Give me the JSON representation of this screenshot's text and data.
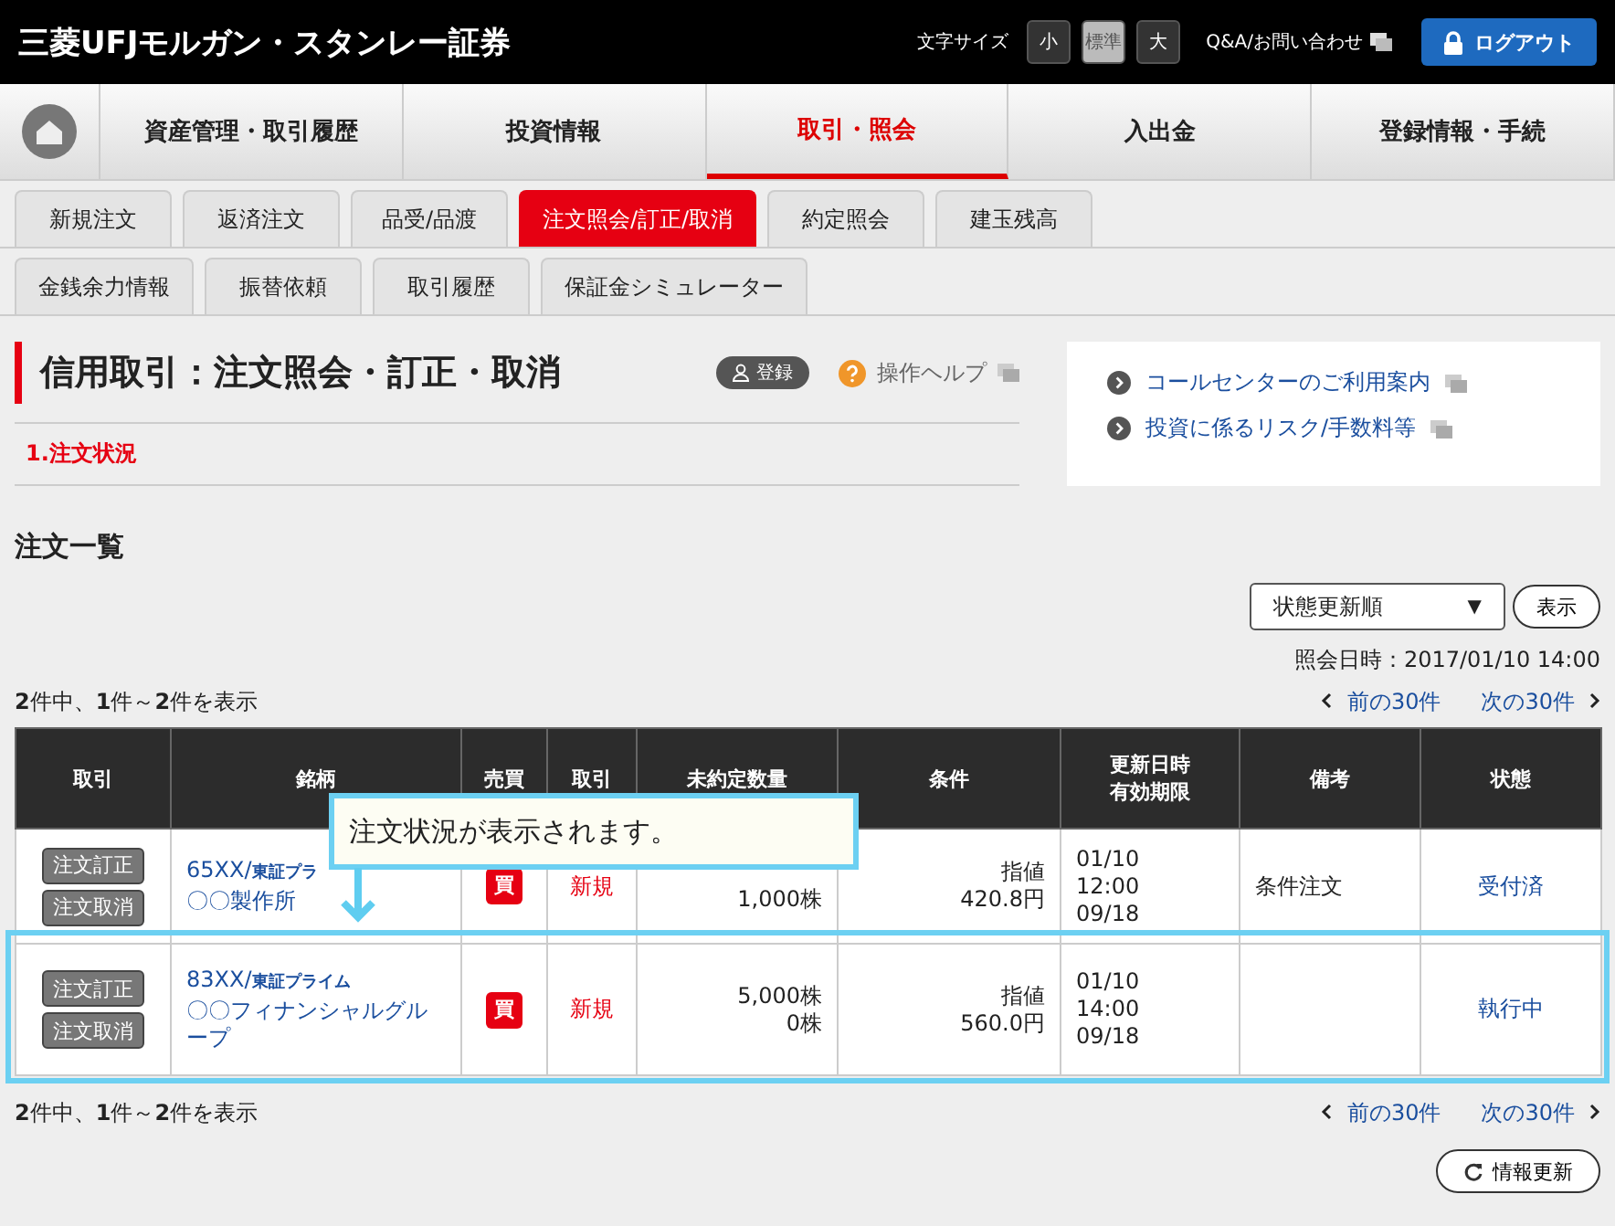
{
  "header": {
    "logo": "三菱UFJモルガン・スタンレー証券",
    "font_size_label": "文字サイズ",
    "font_sizes": [
      {
        "label": "小",
        "selected": false
      },
      {
        "label": "標準",
        "selected": true
      },
      {
        "label": "大",
        "selected": false
      }
    ],
    "help_link": "Q&A/お問い合わせ",
    "logout": "ログアウト"
  },
  "nav": [
    {
      "label": "資産管理・取引履歴",
      "selected": false
    },
    {
      "label": "投資情報",
      "selected": false
    },
    {
      "label": "取引・照会",
      "selected": true
    },
    {
      "label": "入出金",
      "selected": false
    },
    {
      "label": "登録情報・手続",
      "selected": false
    }
  ],
  "subtabs": [
    [
      {
        "label": "新規注文",
        "selected": false
      },
      {
        "label": "返済注文",
        "selected": false
      },
      {
        "label": "品受/品渡",
        "selected": false
      },
      {
        "label": "注文照会/訂正/取消",
        "selected": true
      },
      {
        "label": "約定照会",
        "selected": false
      },
      {
        "label": "建玉残高",
        "selected": false
      }
    ],
    [
      {
        "label": "金銭余力情報",
        "selected": false
      },
      {
        "label": "振替依頼",
        "selected": false
      },
      {
        "label": "取引履歴",
        "selected": false
      },
      {
        "label": "保証金シミュレーター",
        "selected": false
      }
    ]
  ],
  "page": {
    "title": "信用取引：注文照会・訂正・取消",
    "register": "登録",
    "help": "操作ヘルプ",
    "step": "1.注文状況"
  },
  "side_links": [
    "コールセンターのご利用案内",
    "投資に係るリスク/手数料等"
  ],
  "list": {
    "heading": "注文一覧",
    "sort": "状態更新順",
    "sort_caret": "▼",
    "show": "表示",
    "as_of": "照会日時：2017/01/10 14:00",
    "count_top": "**2**件中、**1**件～**2**件を表示",
    "prev": "前の30件",
    "next": "次の30件",
    "count_bottom": "**2**件中、**1**件～**2**件を表示",
    "prev_bottom": "前の30件",
    "next_bottom": "次の30件",
    "refresh": "情報更新"
  },
  "table": {
    "columns": [
      [
        "取引"
      ],
      [
        "銘柄"
      ],
      [
        "売買"
      ],
      [
        "取引"
      ],
      [
        "未約定数量"
      ],
      [
        "条件"
      ],
      [
        "更新日時",
        "有効期限"
      ],
      [
        "備考"
      ],
      [
        "状態"
      ]
    ],
    "rows": [
      {
        "actions": [
          "注文訂正",
          "注文取消"
        ],
        "code": "65XX/",
        "market": "東証プラ",
        "name": "〇〇製作所",
        "side": "買",
        "type": "新規",
        "qty": [
          "1,000株"
        ],
        "cond": [
          "指値",
          "420.8円"
        ],
        "dates": [
          "01/10",
          "12:00",
          "09/18"
        ],
        "note": "条件注文",
        "status": "受付済",
        "highlighted": false
      },
      {
        "actions": [
          "注文訂正",
          "注文取消"
        ],
        "code": "83XX/",
        "market": "東証プライム",
        "name": "〇〇フィナンシャルグループ",
        "side": "買",
        "type": "新規",
        "qty": [
          "5,000株",
          "0株"
        ],
        "cond": [
          "指値",
          "560.0円"
        ],
        "dates": [
          "01/10",
          "14:00",
          "09/18"
        ],
        "note": "",
        "status": "執行中",
        "highlighted": true
      }
    ]
  },
  "callout": {
    "text": "注文状況が表示されます。"
  }
}
